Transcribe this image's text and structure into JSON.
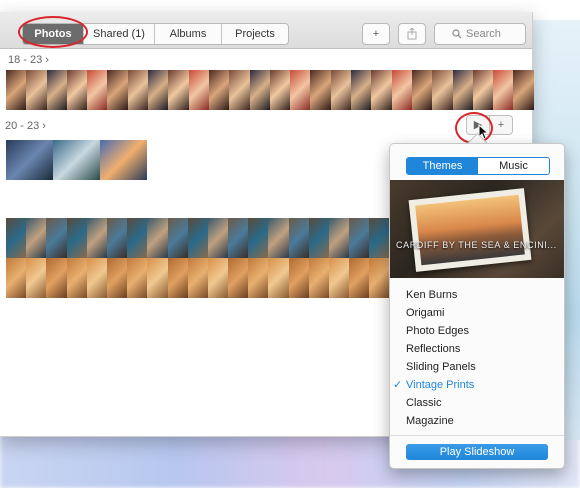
{
  "toolbar": {
    "tabs": [
      {
        "label": "Photos",
        "active": true
      },
      {
        "label": "Shared (1)",
        "active": false
      },
      {
        "label": "Albums",
        "active": false
      },
      {
        "label": "Projects",
        "active": false
      }
    ],
    "add_icon": "plus-icon",
    "share_icon": "share-icon",
    "search_placeholder": "Search"
  },
  "moments": [
    {
      "date": "18 - 23"
    },
    {
      "date": "20 - 23"
    }
  ],
  "popover": {
    "tabs": [
      {
        "label": "Themes",
        "active": true
      },
      {
        "label": "Music",
        "active": false
      }
    ],
    "preview_title": "CARDIFF BY THE SEA & ENCINI...",
    "themes": [
      {
        "label": "Ken Burns",
        "selected": false
      },
      {
        "label": "Origami",
        "selected": false
      },
      {
        "label": "Photo Edges",
        "selected": false
      },
      {
        "label": "Reflections",
        "selected": false
      },
      {
        "label": "Sliding Panels",
        "selected": false
      },
      {
        "label": "Vintage Prints",
        "selected": true
      },
      {
        "label": "Classic",
        "selected": false
      },
      {
        "label": "Magazine",
        "selected": false
      }
    ],
    "play_label": "Play Slideshow"
  },
  "colors": {
    "accent": "#1f86d9",
    "annotation_ring": "#d9262a"
  }
}
